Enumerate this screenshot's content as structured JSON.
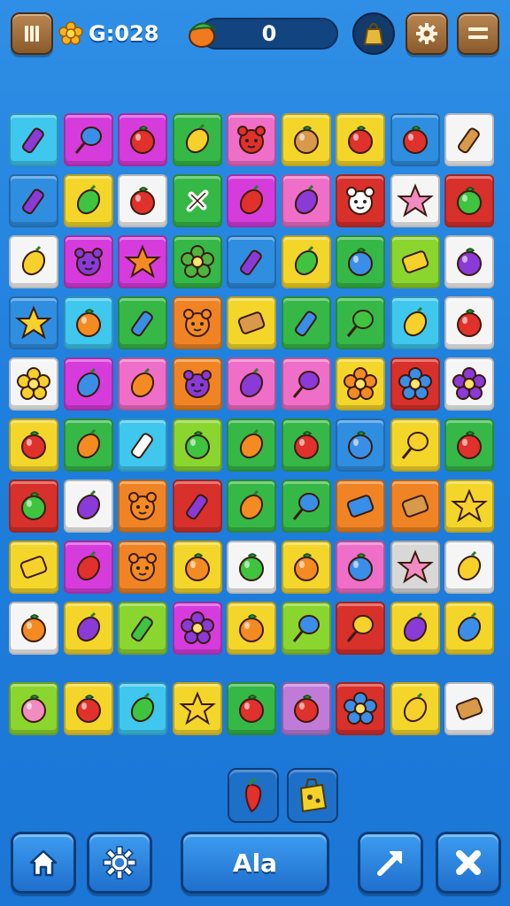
{
  "hud": {
    "pause_icon": "pause-icon",
    "coin_icon": "gold-flower-coin-icon",
    "coin_text": "G:028",
    "score": "0",
    "score_icon": "fruit-icon",
    "bag_icon": "bag-icon",
    "settings_icon": "gear-icon",
    "menu_icon": "menu-icon"
  },
  "palette": {
    "cyan": "#3fc7ee",
    "magenta": "#d63cdc",
    "green": "#36b847",
    "lime": "#8bd52f",
    "yellow": "#f4d62a",
    "red": "#d8302b",
    "white": "#f5f5f5",
    "pink": "#ef6ec8",
    "orange": "#f08424",
    "lilac": "#c07bd8",
    "blue": "#2f8ee0",
    "lightgray": "#d8d8d8",
    "darkred": "#c02a28"
  },
  "board": {
    "rows": [
      [
        [
          "cyan",
          "purple-pepper"
        ],
        [
          "magenta",
          "blue-lollipop"
        ],
        [
          "magenta",
          "strawberry"
        ],
        [
          "green",
          "lemon"
        ],
        [
          "pink",
          "bear-face"
        ],
        [
          "yellow",
          "walnut"
        ],
        [
          "yellow",
          "red-apple"
        ],
        [
          "blue",
          "chili"
        ],
        [
          "white",
          "corn"
        ]
      ],
      [
        [
          "blue",
          "purple-bottle"
        ],
        [
          "yellow",
          "green-plum"
        ],
        [
          "white",
          "tomato"
        ],
        [
          "green",
          "white-cross"
        ],
        [
          "magenta",
          "red-plum"
        ],
        [
          "pink",
          "purple-grape"
        ],
        [
          "red",
          "white-cat"
        ],
        [
          "white",
          "pink-star"
        ],
        [
          "red",
          "green-apple"
        ]
      ],
      [
        [
          "white",
          "yellow-lemon"
        ],
        [
          "magenta",
          "purple-cat"
        ],
        [
          "magenta",
          "orange-star"
        ],
        [
          "green",
          "broccoli"
        ],
        [
          "blue",
          "purple-bottle"
        ],
        [
          "yellow",
          "green-leaf"
        ],
        [
          "green",
          "blue-ball"
        ],
        [
          "lime",
          "yellow-cheese"
        ],
        [
          "white",
          "purple-blob"
        ]
      ],
      [
        [
          "blue",
          "yellow-star"
        ],
        [
          "cyan",
          "orange"
        ],
        [
          "green",
          "blue-bottle"
        ],
        [
          "orange",
          "orange-face"
        ],
        [
          "yellow",
          "bread"
        ],
        [
          "green",
          "blue-bottle"
        ],
        [
          "green",
          "green-lollipop"
        ],
        [
          "cyan",
          "yellow-lemon"
        ],
        [
          "white",
          "red-apple"
        ]
      ],
      [
        [
          "white",
          "sun"
        ],
        [
          "magenta",
          "blue-plum"
        ],
        [
          "pink",
          "orange-plum"
        ],
        [
          "orange",
          "purple-cat"
        ],
        [
          "pink",
          "purple-grape"
        ],
        [
          "pink",
          "purple-lollipop"
        ],
        [
          "yellow",
          "orange-flower"
        ],
        [
          "red",
          "blue-flower"
        ],
        [
          "white",
          "purple-flower"
        ]
      ],
      [
        [
          "yellow",
          "strawberry"
        ],
        [
          "green",
          "orange-plum"
        ],
        [
          "cyan",
          "white-bottle"
        ],
        [
          "lime",
          "green-ball"
        ],
        [
          "green",
          "orange-plum"
        ],
        [
          "green",
          "red-strawberry"
        ],
        [
          "blue",
          "blue-ball"
        ],
        [
          "yellow",
          "yellow-lollipop"
        ],
        [
          "green",
          "chili"
        ]
      ],
      [
        [
          "red",
          "green-apple"
        ],
        [
          "white",
          "purple-grape"
        ],
        [
          "orange",
          "orange-face"
        ],
        [
          "red",
          "purple-pepper"
        ],
        [
          "green",
          "orange-plum"
        ],
        [
          "green",
          "blue-lollipop"
        ],
        [
          "orange",
          "blue-candy"
        ],
        [
          "orange",
          "bread"
        ],
        [
          "yellow",
          "yellow-star"
        ]
      ],
      [
        [
          "yellow",
          "yellow-cheese"
        ],
        [
          "magenta",
          "striped-egg"
        ],
        [
          "orange",
          "orange-bear"
        ],
        [
          "yellow",
          "orange"
        ],
        [
          "white",
          "green-apple"
        ],
        [
          "yellow",
          "orange"
        ],
        [
          "pink",
          "blue-robot"
        ],
        [
          "lightgray",
          "pink-star"
        ],
        [
          "white",
          "yellow-lemon"
        ]
      ],
      [
        [
          "white",
          "orange"
        ],
        [
          "yellow",
          "purple-egg"
        ],
        [
          "lime",
          "green-bottle"
        ],
        [
          "magenta",
          "purple-flower"
        ],
        [
          "yellow",
          "orange"
        ],
        [
          "lime",
          "blue-lollipop"
        ],
        [
          "red",
          "yellow-lollipop"
        ],
        [
          "yellow",
          "purple-plum"
        ],
        [
          "yellow",
          "blue-plum"
        ]
      ],
      [
        [
          "lime",
          "pink-pepper"
        ],
        [
          "yellow",
          "red-apple"
        ],
        [
          "cyan",
          "green-leaf-pepper"
        ],
        [
          "yellow",
          "yellow-star"
        ],
        [
          "green",
          "red-apple"
        ],
        [
          "lilac",
          "beach-ball"
        ],
        [
          "red",
          "blue-flower"
        ],
        [
          "yellow",
          "yellow-lemon"
        ],
        [
          "white",
          "bread"
        ]
      ]
    ]
  },
  "tray": {
    "slots": [
      "red-pepper",
      "yellow-cheese-box"
    ]
  },
  "bottom": {
    "home_icon": "home-icon",
    "settings_icon": "gear-icon",
    "center_label": "Ala",
    "hint_icon": "arrow-icon",
    "shuffle_icon": "cross-icon"
  }
}
